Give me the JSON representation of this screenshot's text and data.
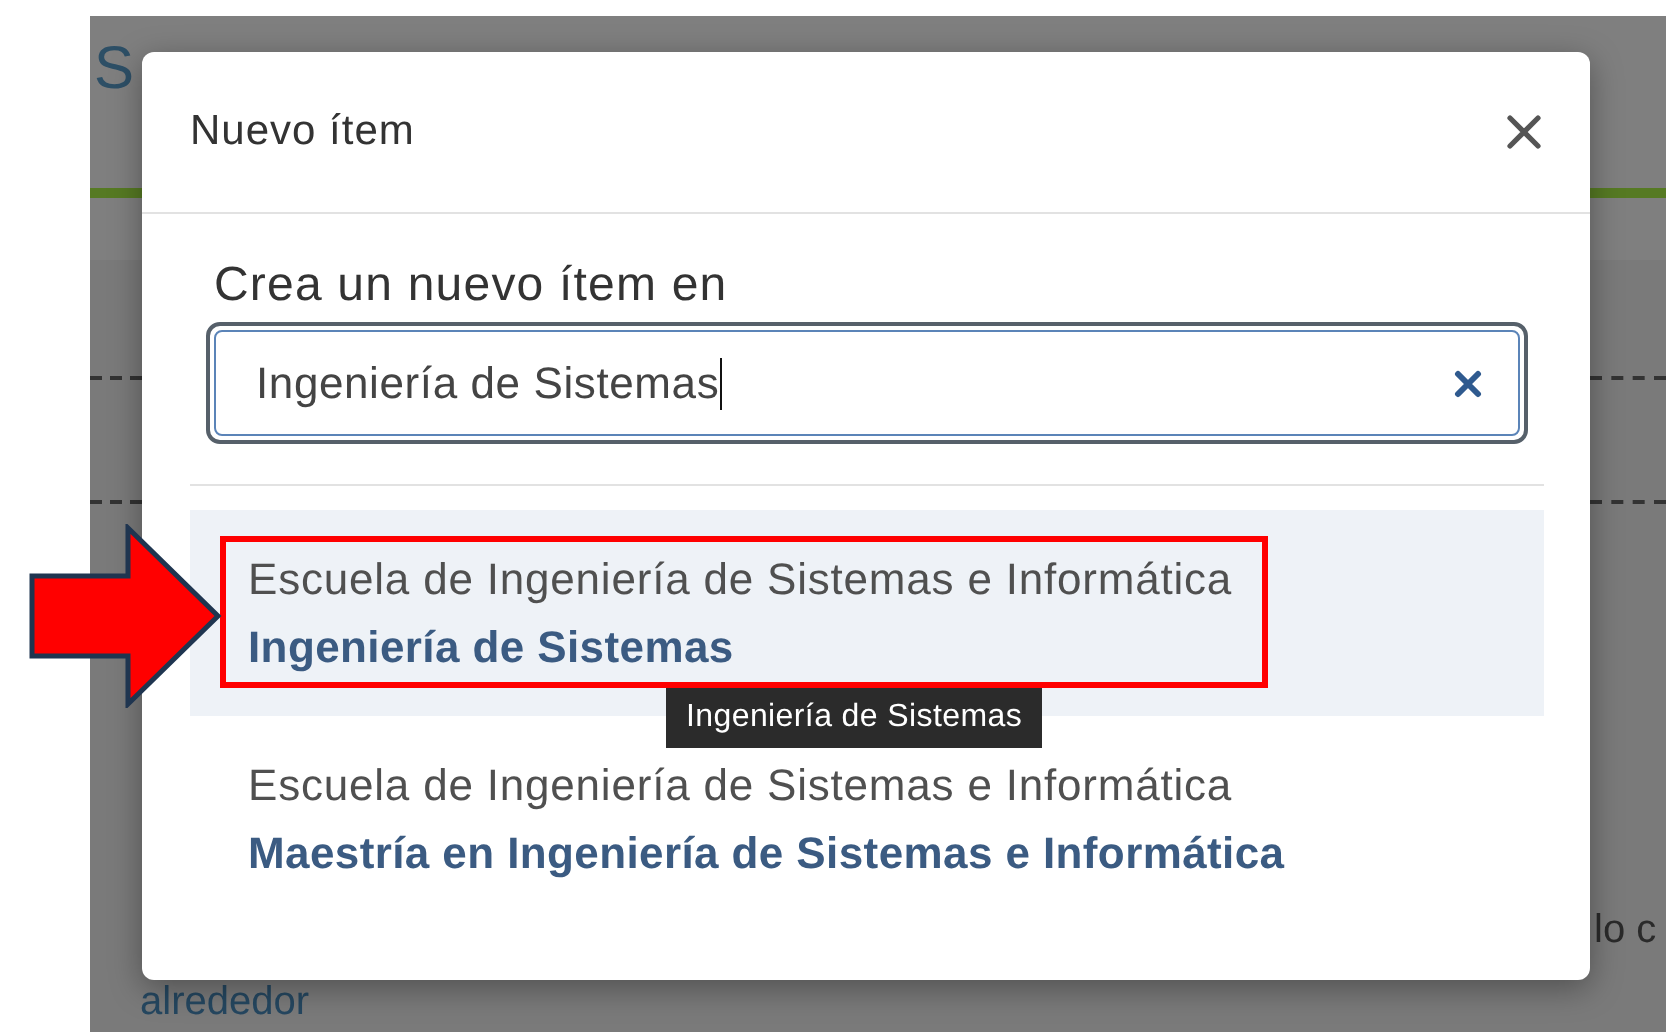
{
  "background_page": {
    "heading_fragment": "S",
    "text_fragment": "lo c",
    "link": "alrededor"
  },
  "dialog": {
    "title": "Nuevo ítem",
    "field": {
      "label": "Crea un nuevo ítem en",
      "value": "Ingeniería de Sistemas"
    },
    "results": [
      {
        "parent": "Escuela de Ingeniería de Sistemas e Informática",
        "name": "Ingeniería de Sistemas",
        "selected": true,
        "annotated": true,
        "tooltip": "Ingeniería de Sistemas"
      },
      {
        "parent": "Escuela de Ingeniería de Sistemas e Informática",
        "name": "Maestría en Ingeniería de Sistemas e Informática",
        "selected": false,
        "annotated": false
      }
    ]
  }
}
